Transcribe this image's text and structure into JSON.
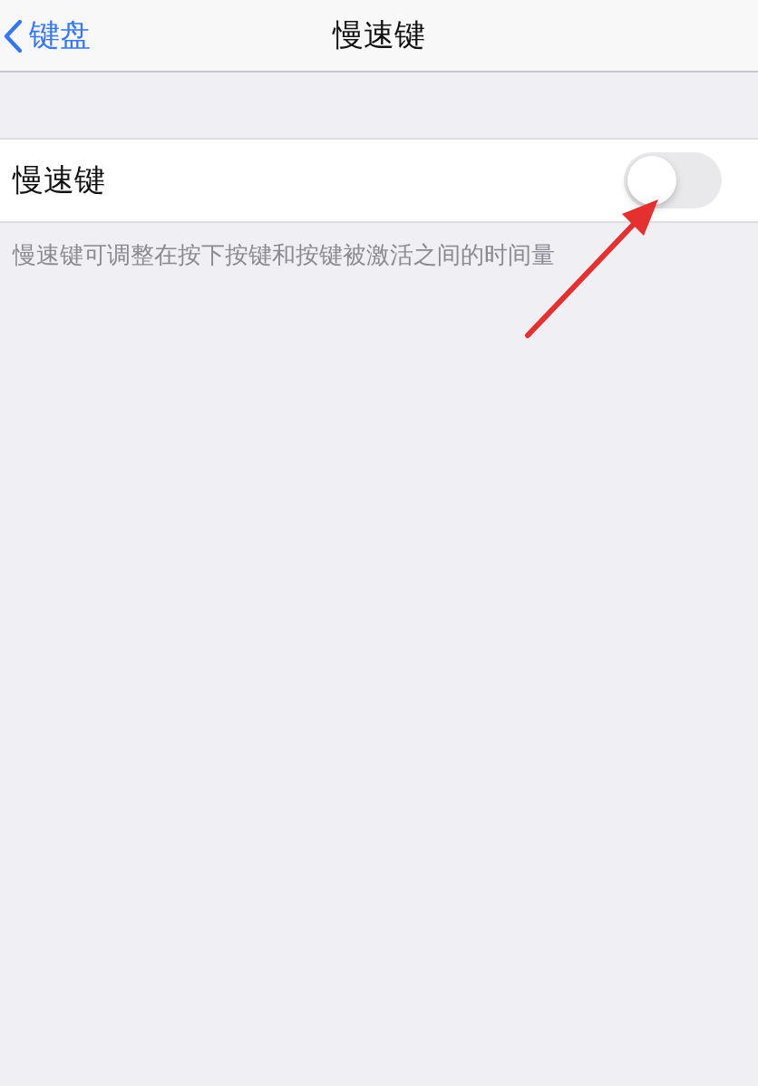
{
  "nav_bar": {
    "back_label": "键盘",
    "title": "慢速键"
  },
  "settings": [
    {
      "kind": "toggle",
      "label": "慢速键",
      "on": false
    }
  ],
  "footer": "慢速键可调整在按下按键和按键被激活之间的时间量"
}
